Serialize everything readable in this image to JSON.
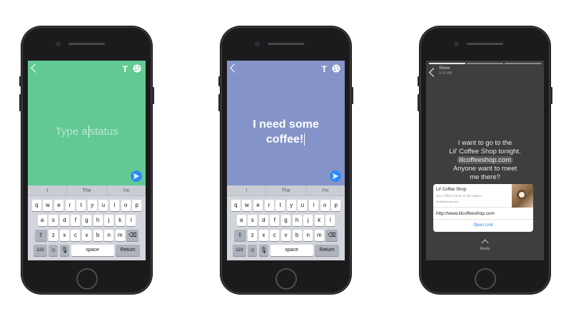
{
  "phones": [
    {
      "status_placeholder_before": "Type a",
      "status_placeholder_after": "status",
      "background": "#62c995"
    },
    {
      "status_line1": "I need some",
      "status_line2": "coffee!",
      "background": "#8494c8"
    },
    {
      "background": "#3e3e3f"
    }
  ],
  "topbar": {
    "text_tool": "T"
  },
  "keyboard": {
    "suggestions": [
      "I",
      "The",
      "I'm"
    ],
    "row1": [
      "q",
      "w",
      "e",
      "r",
      "t",
      "y",
      "u",
      "i",
      "o",
      "p"
    ],
    "row2": [
      "a",
      "s",
      "d",
      "f",
      "g",
      "h",
      "j",
      "k",
      "l"
    ],
    "row3": [
      "z",
      "x",
      "c",
      "v",
      "b",
      "n",
      "m"
    ],
    "numbers_key": "123",
    "space_key": "space",
    "return_key": "Return"
  },
  "story": {
    "sender_name": "Steve",
    "sender_time": "9:41 AM",
    "message_line1": "I want to go to the",
    "message_line2": "Lil' Coffee Shop tonight.",
    "message_link": "lilcoffeeshop.com",
    "message_line3": "Anyone want to meet",
    "message_line4": "me there?",
    "card_title": "Lil' Coffee Shop",
    "card_description": "Our coffee is built on the values...",
    "card_domain": "lilcoffeeshop.com",
    "card_url": "http://www.lilcoffeeshop.com",
    "card_action": "Open Link",
    "reply_label": "Reply"
  },
  "colors": {
    "send_button": "#2b8cf5",
    "link_blue": "#2b7df0"
  }
}
